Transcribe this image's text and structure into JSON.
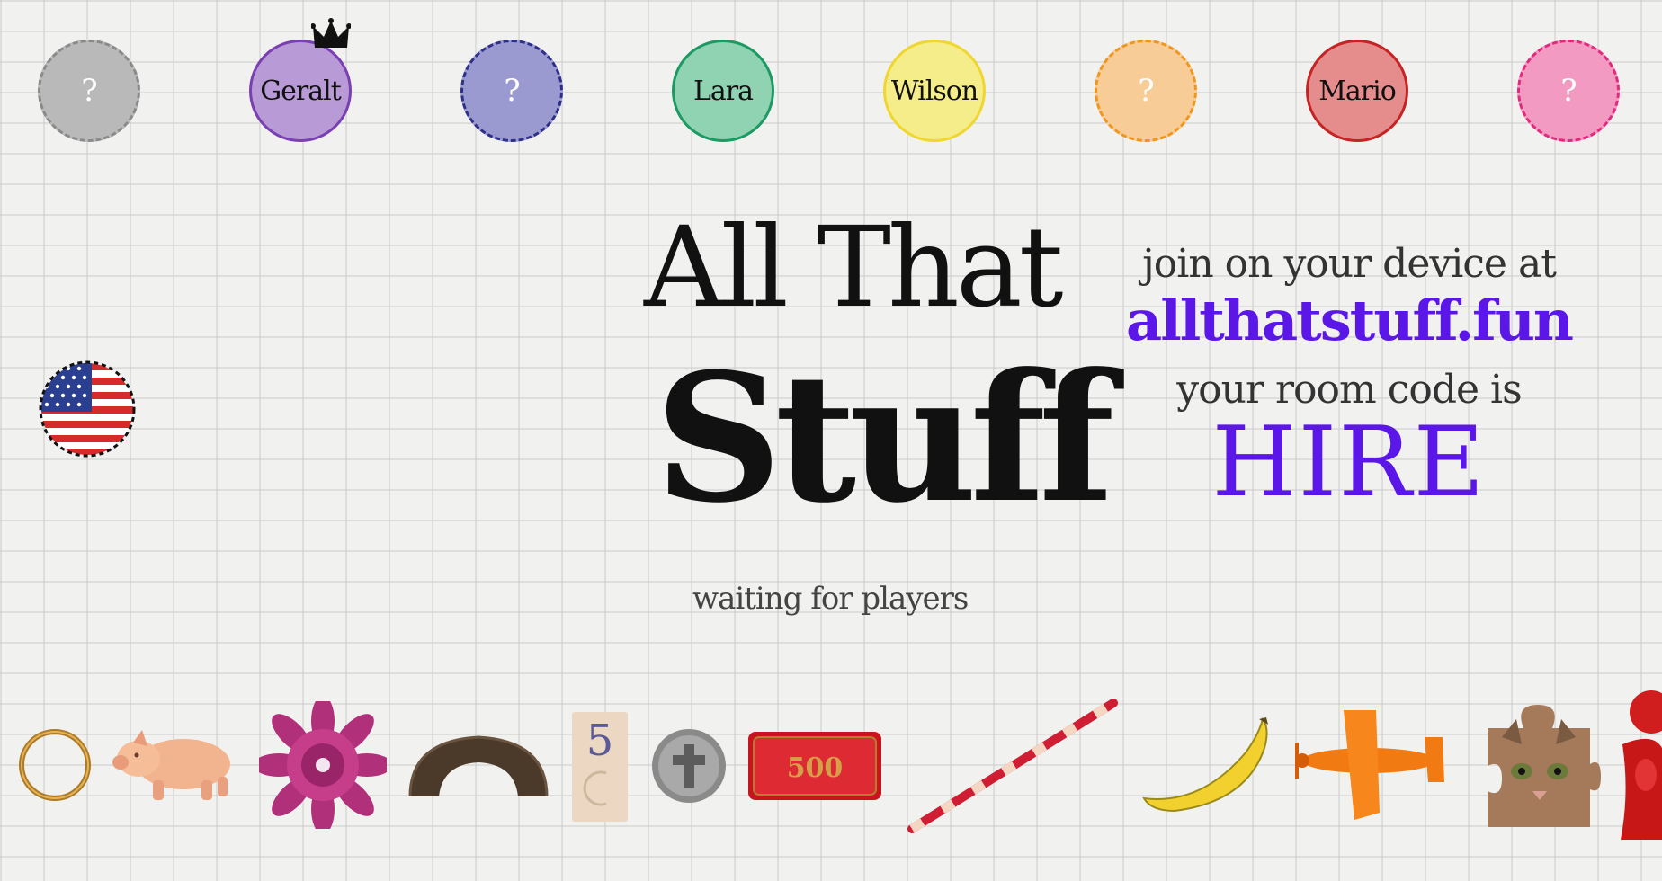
{
  "players": [
    {
      "name": "?",
      "joined": false,
      "bg": "#b9b9b9",
      "border": "#8a8a8a"
    },
    {
      "name": "Geralt",
      "joined": true,
      "host": true,
      "bg": "#b79ad6",
      "border": "#7a3fb0"
    },
    {
      "name": "?",
      "joined": false,
      "bg": "#9a9ad0",
      "border": "#2d2f8a"
    },
    {
      "name": "Lara",
      "joined": true,
      "bg": "#8fd3b2",
      "border": "#1d9a63"
    },
    {
      "name": "Wilson",
      "joined": true,
      "bg": "#f5ec8a",
      "border": "#efd630"
    },
    {
      "name": "?",
      "joined": false,
      "bg": "#f7cc96",
      "border": "#f0961d"
    },
    {
      "name": "Mario",
      "joined": true,
      "bg": "#e58c8c",
      "border": "#c62424"
    },
    {
      "name": "?",
      "joined": false,
      "bg": "#f29ac2",
      "border": "#e2297d"
    }
  ],
  "title": {
    "line1": "All That",
    "line2": "Stuff"
  },
  "status": "waiting for players",
  "join": {
    "prompt": "join on your device at",
    "url": "allthatstuff.fun",
    "room_prompt": "your room code is",
    "room_code": "HIRE"
  },
  "language": {
    "flag": "us-flag-icon"
  },
  "colors": {
    "accent": "#5b16e8",
    "text": "#111111"
  },
  "items": [
    "ring",
    "pig",
    "flower",
    "horseshoe-block",
    "number-card-5",
    "cross-coin",
    "500-chip",
    "striped-stick",
    "banana",
    "toy-airplane",
    "cat-puzzle-piece",
    "red-figurine"
  ],
  "chip_label": "500",
  "card_number": "5"
}
